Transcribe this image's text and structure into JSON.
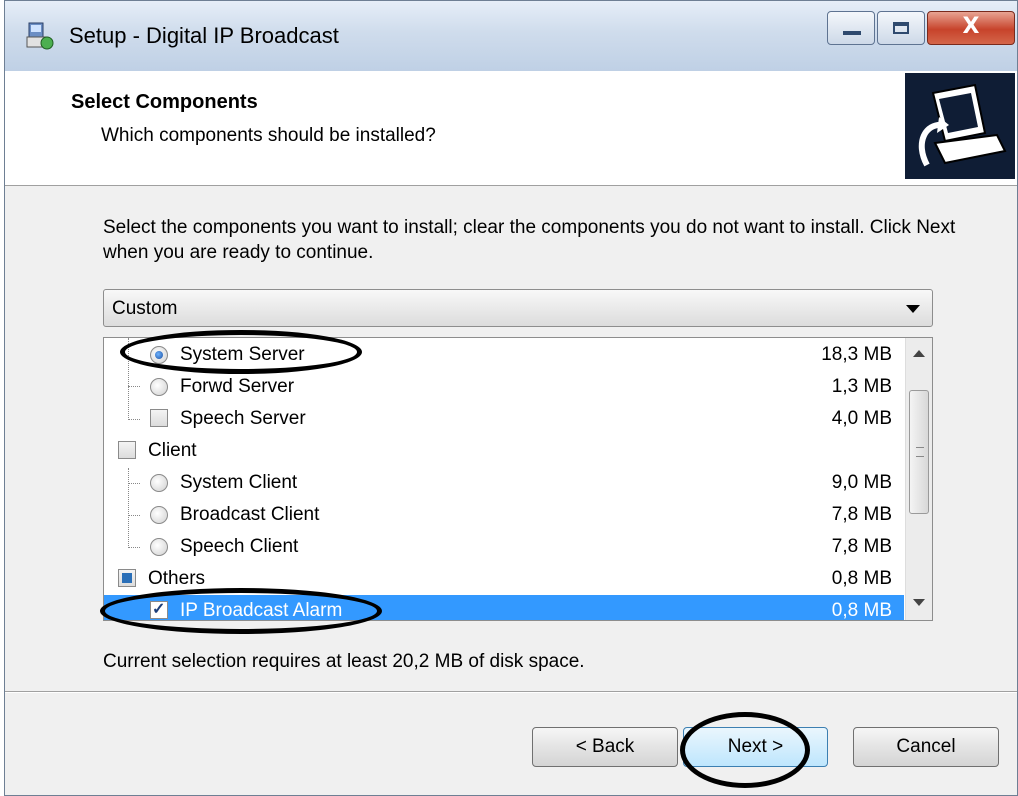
{
  "window": {
    "title": "Setup - Digital IP Broadcast",
    "close_glyph": "X"
  },
  "header": {
    "title": "Select Components",
    "subtitle": "Which components should be installed?",
    "image": "setup-computer-icon"
  },
  "instructions": "Select the components you want to install; clear the components you do not want to install. Click Next when you are ready to continue.",
  "install_type": {
    "selected": "Custom"
  },
  "components": [
    {
      "label": "System Server",
      "size": "18,3 MB",
      "control": "radio",
      "checked": true
    },
    {
      "label": "Forwd Server",
      "size": "1,3 MB",
      "control": "radio",
      "checked": false
    },
    {
      "label": "Speech Server",
      "size": "4,0 MB",
      "control": "checkbox",
      "checked": false
    },
    {
      "label": "Client",
      "size": "",
      "control": "checkbox",
      "checked": false
    },
    {
      "label": "System Client",
      "size": "9,0 MB",
      "control": "radio",
      "checked": false
    },
    {
      "label": "Broadcast Client",
      "size": "7,8 MB",
      "control": "radio",
      "checked": false
    },
    {
      "label": "Speech Client",
      "size": "7,8 MB",
      "control": "radio",
      "checked": false
    },
    {
      "label": "Others",
      "size": "0,8 MB",
      "control": "checkbox",
      "checked": "partial"
    },
    {
      "label": "IP Broadcast Alarm",
      "size": "0,8 MB",
      "control": "checkbox",
      "checked": true,
      "selected": true
    }
  ],
  "disk_space": "Current selection requires at least 20,2 MB of disk space.",
  "buttons": {
    "back": "< Back",
    "next": "Next >",
    "cancel": "Cancel"
  },
  "colors": {
    "selection": "#3399ff",
    "header_image_bg": "#0f1d35"
  }
}
